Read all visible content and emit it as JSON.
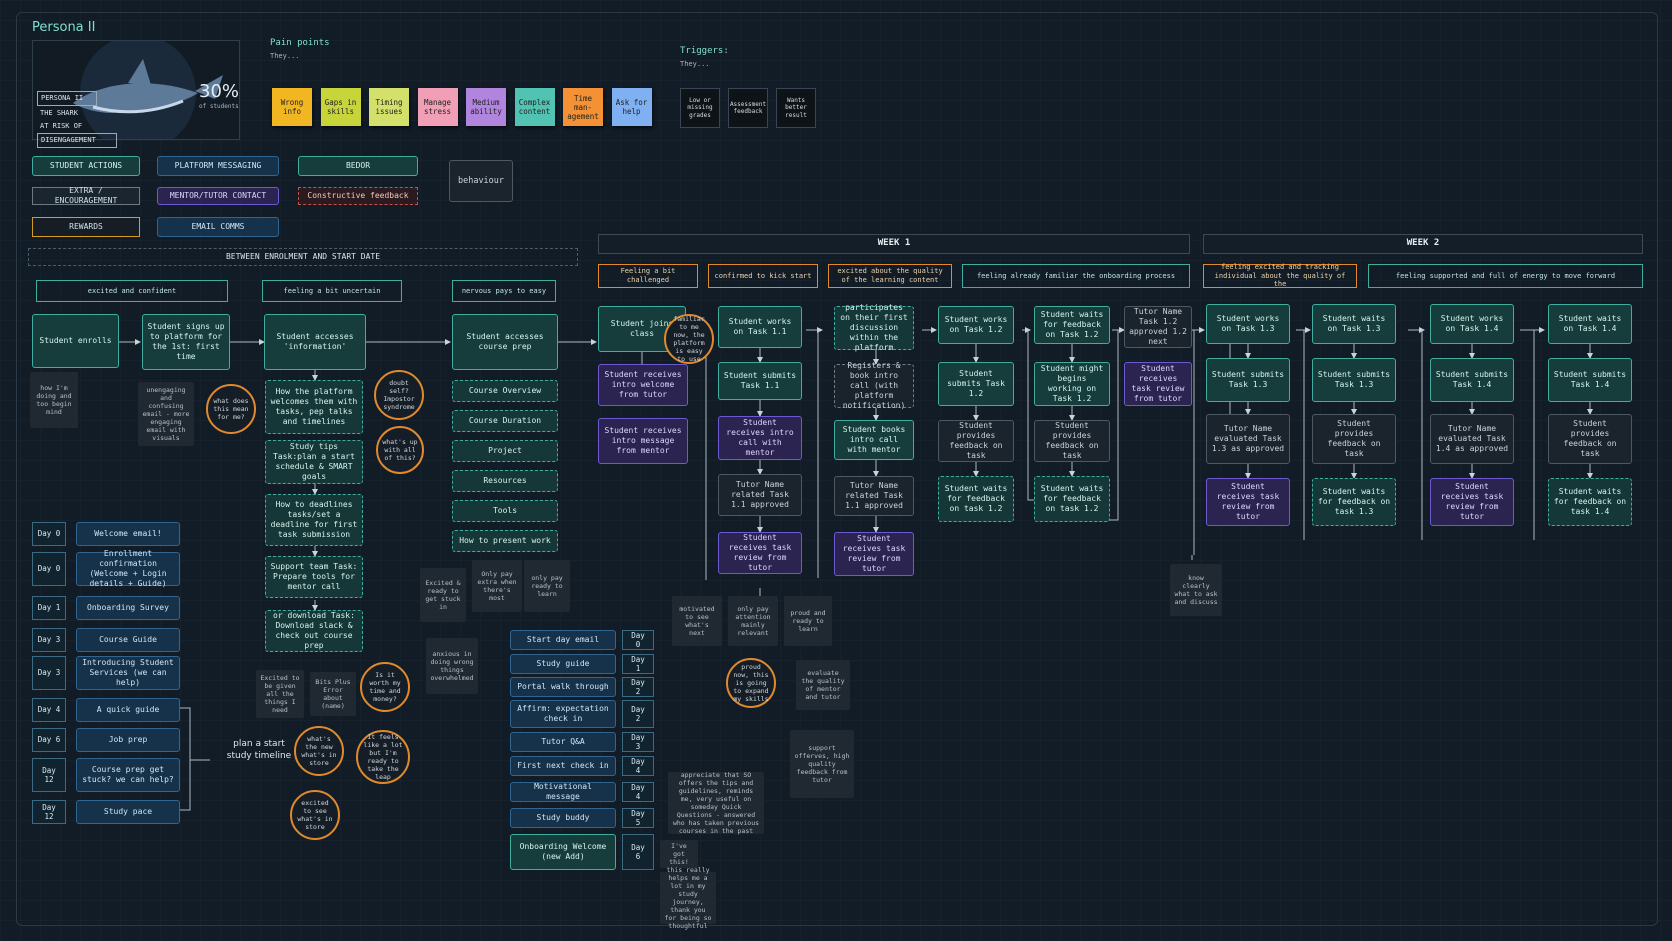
{
  "persona": {
    "title": "Persona II",
    "tag_lines": [
      "PERSONA II",
      "THE SHARK",
      "AT RISK OF",
      "DISENGAGEMENT"
    ],
    "percent": "30%",
    "percent_caption": "of students"
  },
  "pain_points": {
    "heading": "Pain points",
    "subheading": "They...",
    "items": [
      {
        "label": "Wrong info",
        "color": "#f2b623"
      },
      {
        "label": "Gaps in skills",
        "color": "#c7d53a"
      },
      {
        "label": "Timing issues",
        "color": "#d3e06b"
      },
      {
        "label": "Manage stress",
        "color": "#f09fb6"
      },
      {
        "label": "Medium ability",
        "color": "#b184de"
      },
      {
        "label": "Complex content",
        "color": "#52c3b3"
      },
      {
        "label": "Time man-agement",
        "color": "#f39134"
      },
      {
        "label": "Ask for help",
        "color": "#7fb0f2"
      }
    ]
  },
  "triggers": {
    "heading": "Triggers:",
    "subheading": "They...",
    "items": [
      "Low or missing grades",
      "Assessment feedback",
      "Wants better result"
    ]
  },
  "legend": {
    "student_actions": "STUDENT ACTIONS",
    "platform_messaging": "PLATFORM MESSAGING",
    "bedor": "BEDOR",
    "behaviour": "behaviour",
    "extra": "EXTRA / ENCOURAGEMENT",
    "mentor": "MENTOR/TUTOR CONTACT",
    "constructive": "Constructive feedback",
    "rewards": "REWARDS",
    "email": "EMAIL COMMS"
  },
  "section_headers": {
    "enrolment": "BETWEEN ENROLMENT AND START DATE",
    "week1": "WEEK 1",
    "week2": "WEEK 2"
  },
  "feelings": {
    "f1": "excited and confident",
    "f2": "feeling a bit uncertain",
    "f3": "nervous pays to easy",
    "w1a": "Feeling a bit challenged",
    "w1b": "confirmed to kick start",
    "w1c": "excited about the quality of the learning content",
    "w1d": "feeling already familiar the onboarding process",
    "w2a": "feeling excited and tracking individual about the quality of the",
    "w2b": "feeling supported and full of energy to move forward"
  },
  "enrol_flow": {
    "enrolls": "Student enrolls",
    "signs_up": "Student signs up to platform for the 1st: first time",
    "accesses_info": "Student accesses 'information'",
    "accesses_prep": "Student accesses course prep",
    "info_steps": [
      "How the platform welcomes them with tasks, pep talks and timelines",
      "Study tips Task:plan a start schedule & SMART goals",
      "How to deadlines tasks/set a deadline for first task submission",
      "Support team Task: Prepare tools for mentor call",
      "or download Task: Download slack & check out course prep"
    ],
    "prep_items": [
      "Course Overview",
      "Course Duration",
      "Project",
      "Resources",
      "Tools",
      "How to present work"
    ]
  },
  "w1_col1": {
    "joins": "Student joins class",
    "welcome_tutor": "Student receives intro welcome from tutor",
    "msg_mentor": "Student receives intro message from mentor"
  },
  "w1_col2": {
    "works": "Student works on Task 1.1",
    "submits": "Student submits Task 1.1",
    "intro_call": "Student receives intro call with mentor",
    "approved": "Tutor Name related Task 1.1 approved",
    "review": "Student receives task review from tutor"
  },
  "w1_col3": {
    "participates": "participates on their first discussion within the platform",
    "registers": "Registers & book intro call (with platform notification)",
    "books": "Student books intro call with mentor",
    "approved": "Tutor Name related Task 1.1 approved",
    "review": "Student receives task review from tutor"
  },
  "w1_col4": {
    "works": "Student works on Task 1.2",
    "submits": "Student submits Task 1.2",
    "provides": "Student provides feedback on task",
    "waits": "Student waits for feedback on task 1.2"
  },
  "w1_col5": {
    "waits_top": "Student waits for feedback on Task 1.2",
    "begins": "Student might begins working on Task 1.2",
    "provides": "Student provides feedback on task",
    "waits": "Student waits for feedback on task 1.2"
  },
  "w1_col6": {
    "approved": "Tutor Name Task 1.2 approved 1.2 next",
    "review": "Student receives task review from tutor"
  },
  "w2_col1": {
    "works": "Student works on Task 1.3",
    "submits": "Student submits Task 1.3",
    "evaluated": "Tutor Name evaluated Task 1.3 as approved",
    "review": "Student receives task review from tutor"
  },
  "w2_col2": {
    "waits_top": "Student waits on Task 1.3",
    "submits": "Student submits Task 1.3",
    "provides": "Student provides feedback on task",
    "waits": "Student waits for feedback on task 1.3"
  },
  "w2_col3": {
    "works": "Student works on Task 1.4",
    "submits": "Student submits Task 1.4",
    "evaluated": "Tutor Name evaluated Task 1.4 as approved",
    "review": "Student receives task review from tutor"
  },
  "w2_col4": {
    "waits_top": "Student waits on Task 1.4",
    "submits": "Student submits Task 1.4",
    "provides": "Student provides feedback on task",
    "waits": "Student waits for feedback on task 1.4"
  },
  "notes": {
    "n1": "how I'm doing and too begin mind",
    "n2": "unengaging and confusing email - more engaging email with visuals",
    "n3": "Excited & ready to get stuck in",
    "n4": "Only pay extra when there's most",
    "n5": "only pay ready to learn",
    "n6": "anxious in doing wrong things overwhelmed",
    "n7": "Excited to be given all the things I need",
    "n8": "Bits Plus Error about (name)",
    "n9": "motivated to see what's next",
    "n10": "only pay attention mainly relevant",
    "n11": "proud and ready to learn",
    "n12": "evaluate the quality of mentor and tutor",
    "n13": "support offerves, high quality feedback from tutor",
    "n14": "appreciate that SO offers the tips and guidelines, reminds me, very useful on someday Quick Questions - answered who has taken previous courses in the past",
    "n15": "I've got this!",
    "n16": "this really helps me a lot in my study journey, thank you for being so thoughtful",
    "n17": "know clearly what to ask and discuss"
  },
  "circles": {
    "c1": "what does this mean for me?",
    "c2": "doubt self? Impostor syndrome",
    "c3": "what's up with all of this?",
    "c4": "Is it worth my time and money?",
    "c5": "what's the new what's in store",
    "c6": "It feels like a lot but I'm ready to take the leap",
    "c7": "excited to see what's in store",
    "c8": "familiar to me now, the platform is easy to use",
    "c9": "proud now, this is going to expand my skills"
  },
  "timeline_left": {
    "items": [
      {
        "day": "Day 0",
        "label": "Welcome email!"
      },
      {
        "day": "Day 0",
        "label": "Enrollment confirmation (Welcome + Login details + Guide)"
      },
      {
        "day": "Day 1",
        "label": "Onboarding Survey"
      },
      {
        "day": "Day 3",
        "label": "Course Guide"
      },
      {
        "day": "Day 3",
        "label": "Introducing Student Services (we can help)"
      },
      {
        "day": "Day 4",
        "label": "A quick guide"
      },
      {
        "day": "Day 6",
        "label": "Job prep"
      },
      {
        "day": "Day 12",
        "label": "Course prep get stuck? we can help?"
      },
      {
        "day": "Day 12",
        "label": "Study pace"
      }
    ],
    "bracket_label": "plan a start study timeline"
  },
  "timeline_right": {
    "items": [
      {
        "label": "Start day email",
        "day": "Day 0"
      },
      {
        "label": "Study guide",
        "day": "Day 1"
      },
      {
        "label": "Portal walk through",
        "day": "Day 2"
      },
      {
        "label": "Affirm: expectation check in",
        "day": "Day 2"
      },
      {
        "label": "Tutor Q&A",
        "day": "Day 3"
      },
      {
        "label": "First next check in",
        "day": "Day 4"
      },
      {
        "label": "Motivational message",
        "day": "Day 4"
      },
      {
        "label": "Study buddy",
        "day": "Day 5"
      },
      {
        "label": "Onboarding Welcome (new Add)",
        "day": "Day 6"
      }
    ]
  }
}
